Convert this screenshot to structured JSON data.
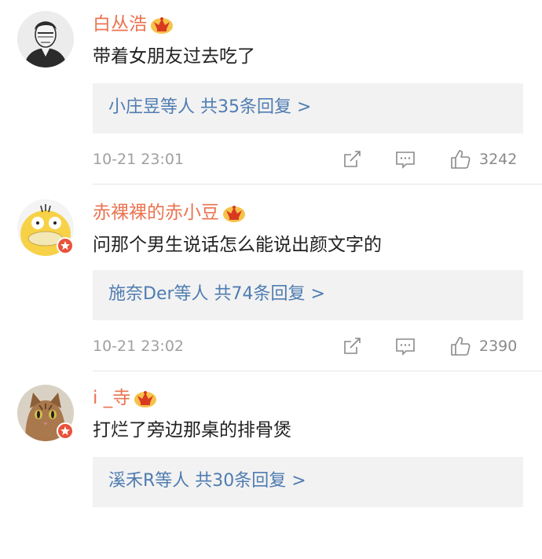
{
  "comments": [
    {
      "username": "白丛浩",
      "text": "带着女朋友过去吃了",
      "replies_link": "小庄昱等人 共35条回复 >",
      "timestamp": "10-21 23:01",
      "likes": "3242",
      "avatar_icon": "sketch-portrait-avatar",
      "verified": false
    },
    {
      "username": "赤裸裸的赤小豆",
      "text": "问那个男生说话怎么能说出颜文字的",
      "replies_link": "施奈Der等人 共74条回复 >",
      "timestamp": "10-21 23:02",
      "likes": "2390",
      "avatar_icon": "psyduck-avatar",
      "verified": true
    },
    {
      "username": "i _寺",
      "text": "打烂了旁边那桌的排骨煲",
      "replies_link": "溪禾R等人 共30条回复 >",
      "avatar_icon": "cat-avatar",
      "verified": true
    }
  ],
  "colors": {
    "username": "#eb7350",
    "link": "#4f7cb1",
    "reply_bg": "#f2f2f2",
    "badge": "#e8523a",
    "crown": "#f1a23a"
  },
  "icons": {
    "share": "share-icon",
    "comment": "comment-icon",
    "like": "thumbs-up-icon",
    "member": "crown-icon"
  }
}
